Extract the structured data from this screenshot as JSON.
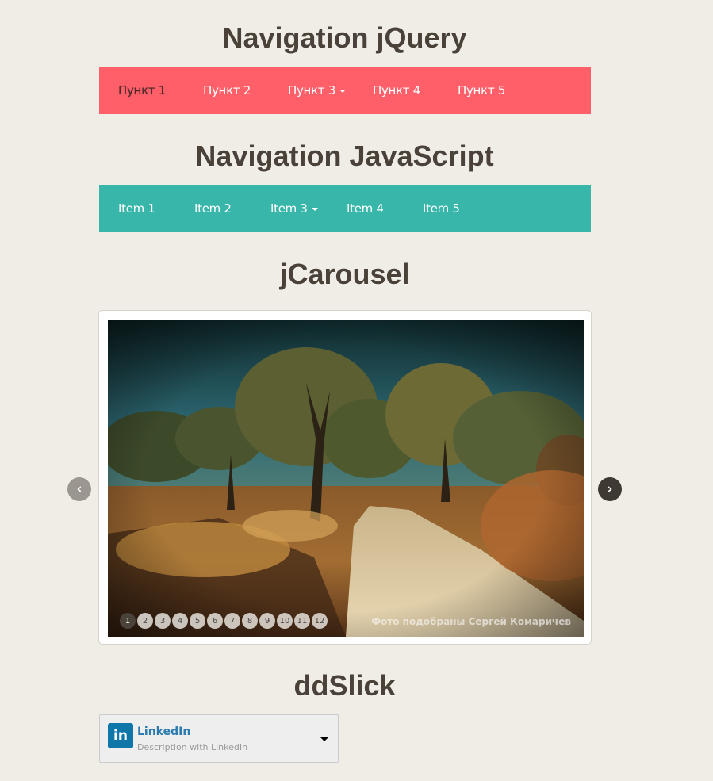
{
  "nav_jquery": {
    "heading": "Navigation jQuery",
    "bg_color": "#fe5f69",
    "items": [
      {
        "label": "Пункт 1"
      },
      {
        "label": "Пункт 2"
      },
      {
        "label": "Пункт 3"
      },
      {
        "label": "Пункт 4"
      },
      {
        "label": "Пункт 5"
      }
    ]
  },
  "nav_javascript": {
    "heading": "Navigation JavaScript",
    "bg_color": "#39b6aa",
    "items": [
      {
        "label": "Item 1"
      },
      {
        "label": "Item 2"
      },
      {
        "label": "Item 3"
      },
      {
        "label": "Item 4"
      },
      {
        "label": "Item 5"
      }
    ]
  },
  "carousel": {
    "heading": "jCarousel",
    "prev_icon": "chevron-left-icon",
    "next_icon": "chevron-right-icon",
    "prev_label": "‹",
    "next_label": "›",
    "pages": [
      "1",
      "2",
      "3",
      "4",
      "5",
      "6",
      "7",
      "8",
      "9",
      "10",
      "11",
      "12"
    ],
    "active_page": "1",
    "credit_text": "Фото подобраны",
    "credit_link": "Сергей Комаричев"
  },
  "ddslick": {
    "heading": "ddSlick",
    "selected": {
      "icon": "linkedin-icon",
      "icon_text": "in",
      "title": "LinkedIn",
      "description": "Description with LinkedIn"
    }
  }
}
